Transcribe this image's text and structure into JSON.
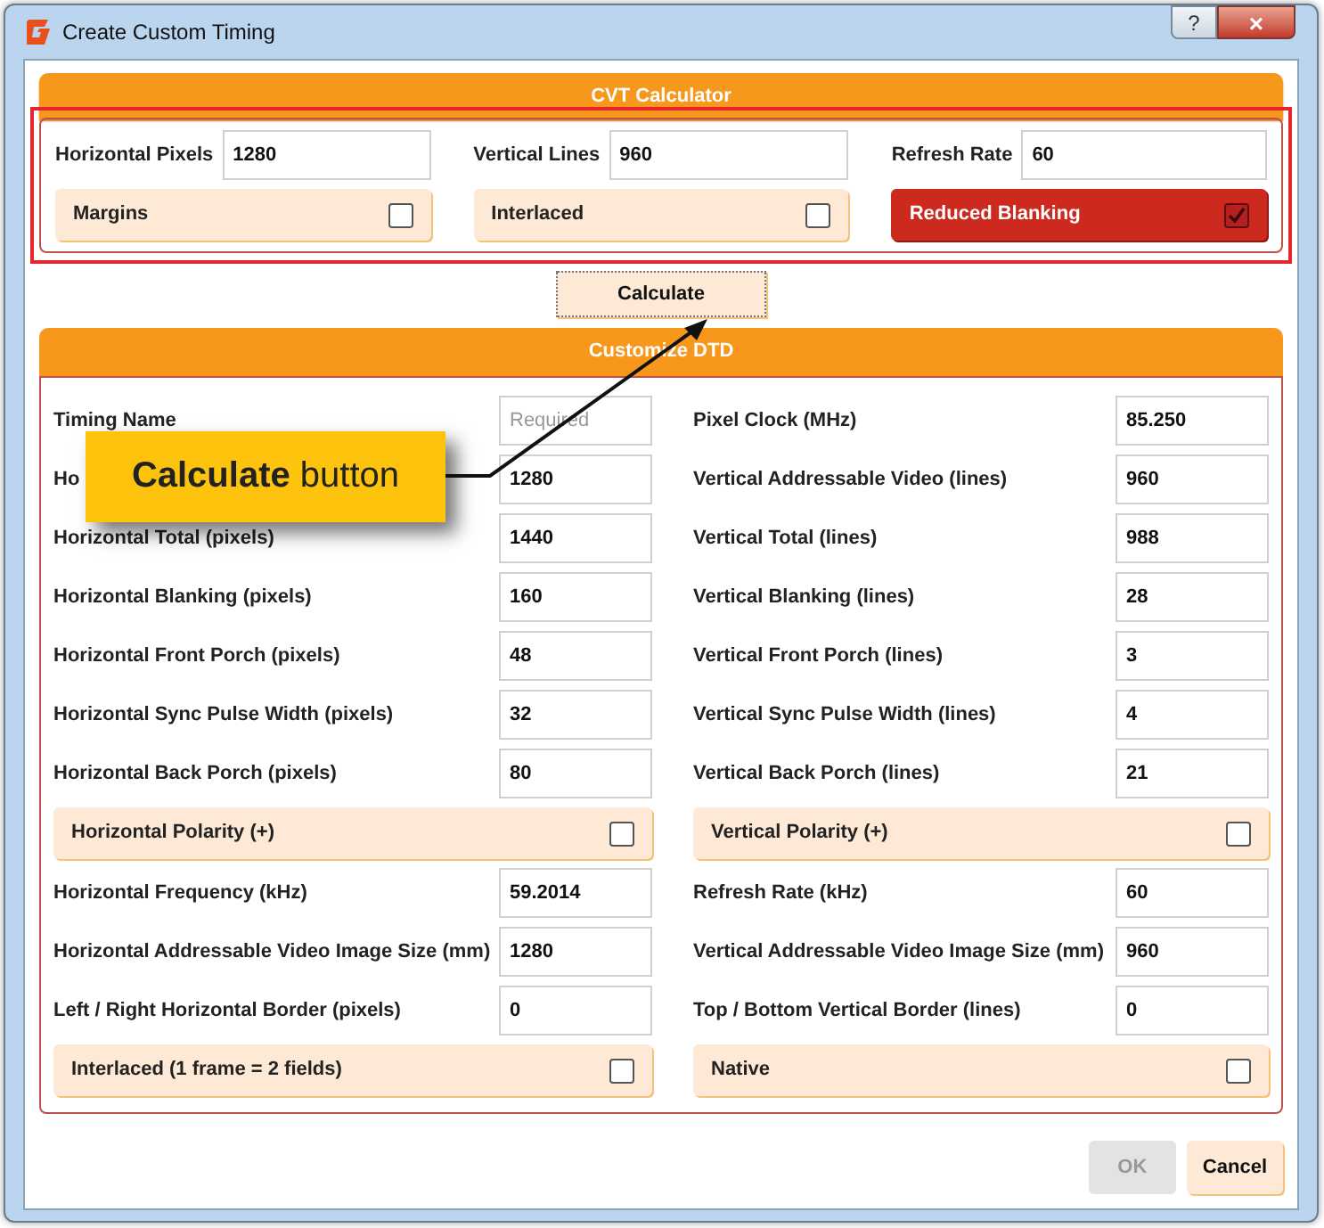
{
  "window": {
    "title": "Create Custom Timing",
    "help": "?",
    "close": "×"
  },
  "cvt": {
    "header": "CVT Calculator",
    "fields": [
      {
        "label": "Horizontal Pixels",
        "value": "1280"
      },
      {
        "label": "Vertical Lines",
        "value": "960"
      },
      {
        "label": "Refresh Rate",
        "value": "60"
      }
    ],
    "toggles": [
      {
        "label": "Margins",
        "checked": false
      },
      {
        "label": "Interlaced",
        "checked": false
      },
      {
        "label": "Reduced Blanking",
        "checked": true
      }
    ]
  },
  "calculate_button": "Calculate",
  "dtd": {
    "header": "Customize DTD",
    "left": [
      {
        "kind": "field",
        "label": "Timing Name",
        "placeholder": "Required"
      },
      {
        "kind": "field",
        "label": "Ho",
        "value": "1280"
      },
      {
        "kind": "field",
        "label": "Horizontal Total (pixels)",
        "value": "1440"
      },
      {
        "kind": "field",
        "label": "Horizontal Blanking (pixels)",
        "value": "160"
      },
      {
        "kind": "field",
        "label": "Horizontal Front Porch (pixels)",
        "value": "48"
      },
      {
        "kind": "field",
        "label": "Horizontal Sync Pulse Width (pixels)",
        "value": "32"
      },
      {
        "kind": "field",
        "label": "Horizontal Back Porch (pixels)",
        "value": "80"
      },
      {
        "kind": "toggle",
        "label": "Horizontal Polarity (+)",
        "checked": false
      },
      {
        "kind": "field",
        "label": "Horizontal Frequency (kHz)",
        "value": "59.2014"
      },
      {
        "kind": "field",
        "label": "Horizontal Addressable Video Image Size (mm)",
        "value": "1280"
      },
      {
        "kind": "field",
        "label": "Left / Right Horizontal Border (pixels)",
        "value": "0"
      },
      {
        "kind": "toggle",
        "label": "Interlaced (1 frame = 2 fields)",
        "checked": false
      }
    ],
    "right": [
      {
        "kind": "field",
        "label": "Pixel Clock (MHz)",
        "value": "85.250"
      },
      {
        "kind": "field",
        "label": "Vertical Addressable Video (lines)",
        "value": "960"
      },
      {
        "kind": "field",
        "label": "Vertical Total (lines)",
        "value": "988"
      },
      {
        "kind": "field",
        "label": "Vertical Blanking (lines)",
        "value": "28"
      },
      {
        "kind": "field",
        "label": "Vertical Front Porch (lines)",
        "value": "3"
      },
      {
        "kind": "field",
        "label": "Vertical Sync Pulse Width (lines)",
        "value": "4"
      },
      {
        "kind": "field",
        "label": "Vertical Back Porch (lines)",
        "value": "21"
      },
      {
        "kind": "toggle",
        "label": "Vertical Polarity (+)",
        "checked": false
      },
      {
        "kind": "field",
        "label": "Refresh Rate (kHz)",
        "value": "60"
      },
      {
        "kind": "field",
        "label": "Vertical Addressable Video Image Size (mm)",
        "value": "960"
      },
      {
        "kind": "field",
        "label": "Top / Bottom Vertical Border (lines)",
        "value": "0"
      },
      {
        "kind": "toggle",
        "label": "Native",
        "checked": false
      }
    ]
  },
  "callout": "**Calculate** button",
  "buttons": [
    {
      "label": "OK",
      "disabled": true
    },
    {
      "label": "Cancel",
      "disabled": false
    }
  ]
}
